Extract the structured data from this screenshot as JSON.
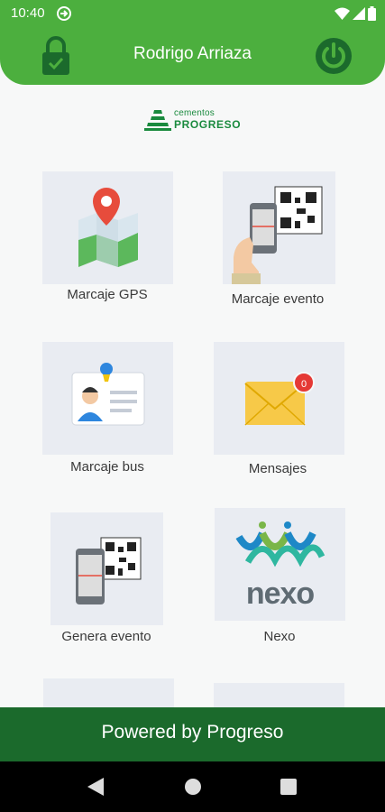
{
  "status_bar": {
    "time": "10:40"
  },
  "header": {
    "user_name": "Rodrigo Arriaza"
  },
  "logo": {
    "line1": "cementos",
    "line2": "PROGRESO"
  },
  "tiles": [
    {
      "label": "Marcaje GPS"
    },
    {
      "label": "Marcaje evento"
    },
    {
      "label": "Marcaje bus"
    },
    {
      "label": "Mensajes",
      "badge": "0"
    },
    {
      "label": "Genera evento"
    },
    {
      "label": "Nexo",
      "logo_text": "nexo"
    }
  ],
  "footer": {
    "text": "Powered by Progreso"
  },
  "colors": {
    "primary": "#4caf3e",
    "footer": "#1b6a2c",
    "tile_bg": "#e9ecf2",
    "badge": "#e53935"
  }
}
